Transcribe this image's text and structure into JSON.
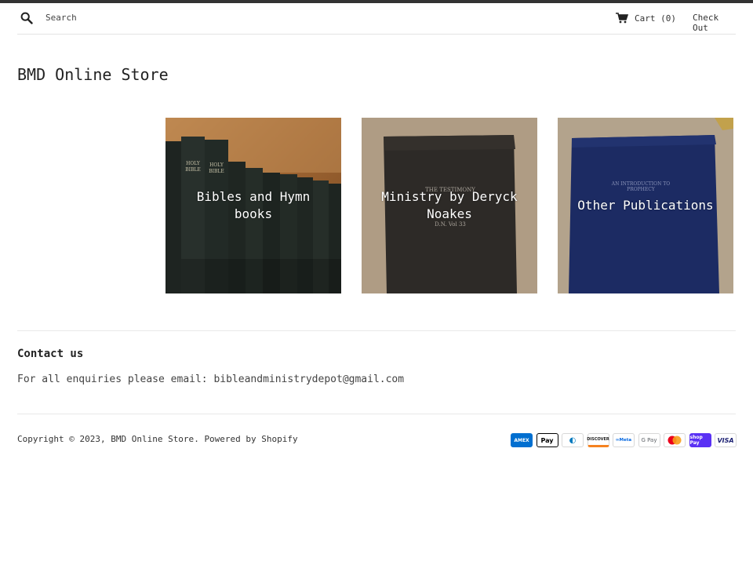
{
  "header": {
    "search_placeholder": "Search",
    "cart_label": "Cart (0)",
    "checkout_label": "Check Out"
  },
  "site": {
    "title": "BMD Online Store"
  },
  "collections": [
    {
      "label": "Bibles and Hymn books"
    },
    {
      "label": "Ministry by Deryck Noakes"
    },
    {
      "label": "Other Publications"
    }
  ],
  "book_text": {
    "bible_spine": "HOLY BIBLE",
    "ministry_cover_line1": "THE TESTIMONY",
    "ministry_cover_line2": "D.N. Vol 33",
    "prophecy_cover_title": "AN INTRODUCTION TO PROPHECY"
  },
  "contact": {
    "title": "Contact us",
    "text": "For all enquiries please email: bibleandministrydepot@gmail.com"
  },
  "footer": {
    "copyright_prefix": "Copyright © 2023,",
    "store_link": "BMD Online Store",
    "powered_by": "Powered by Shopify",
    "payment_methods": [
      {
        "name": "American Express",
        "text": "AMEX",
        "color": "#016fd0"
      },
      {
        "name": "Apple Pay",
        "text": "Pay",
        "color": "#000000"
      },
      {
        "name": "Diners Club",
        "text": "◐",
        "color": "#0079be"
      },
      {
        "name": "Discover",
        "text": "DISCOVER",
        "color": "#f58220"
      },
      {
        "name": "Meta Pay",
        "text": "∞Meta",
        "color": "#0668e1"
      },
      {
        "name": "Google Pay",
        "text": "G Pay",
        "color": "#5f6368"
      },
      {
        "name": "Mastercard",
        "text": "",
        "color": "#eb001b"
      },
      {
        "name": "Shop Pay",
        "text": "shop Pay",
        "color": "#5a31f4"
      },
      {
        "name": "Visa",
        "text": "VISA",
        "color": "#1a1f71"
      }
    ]
  },
  "colors": {
    "top_bar": "#333333",
    "divider": "#e8e8e8",
    "text": "#222222"
  }
}
